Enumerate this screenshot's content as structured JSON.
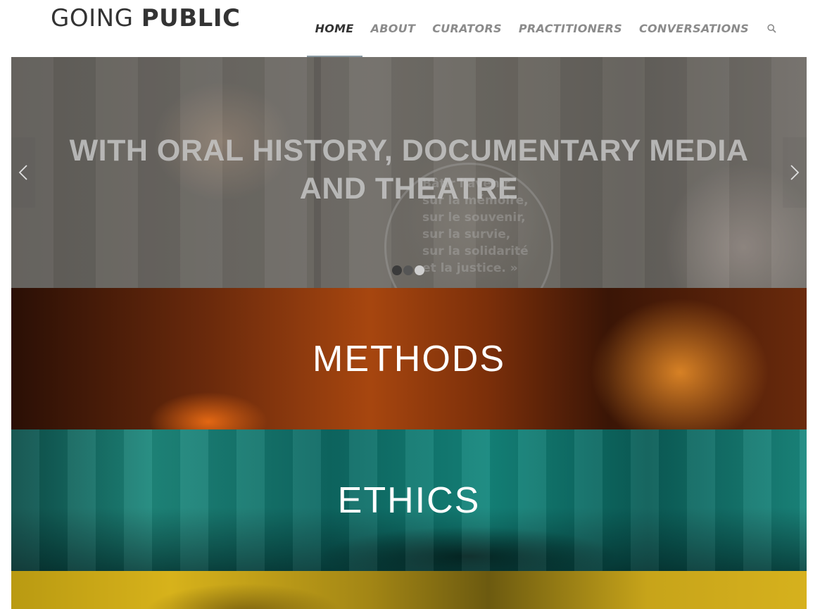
{
  "site": {
    "logo_part1": "GOING",
    "logo_part2": "PUBLIC"
  },
  "nav": {
    "items": [
      {
        "label": "HOME",
        "active": true
      },
      {
        "label": "ABOUT",
        "active": false
      },
      {
        "label": "CURATORS",
        "active": false
      },
      {
        "label": "PRACTITIONERS",
        "active": false
      },
      {
        "label": "CONVERSATIONS",
        "active": false
      }
    ],
    "search_icon": "search-icon"
  },
  "slider": {
    "title": "WITH ORAL HISTORY, DOCUMENTARY MEDIA AND THEATRE",
    "background_text": "Bâtir l'avenir\nsur la mémoire,\nsur le souvenir,\nsur la survie,\nsur la solidarité\net la justice. »",
    "prev_icon": "chevron-left-icon",
    "next_icon": "chevron-right-icon",
    "slide_count": 3,
    "active_slide": 3
  },
  "sections": [
    {
      "title": "METHODS",
      "tint": "#a7460f"
    },
    {
      "title": "ETHICS",
      "tint": "#1f8a7e"
    },
    {
      "title": "",
      "tint": "#d7b21b"
    }
  ],
  "colors": {
    "nav_active": "#333333",
    "nav_inactive": "#8b8b8b",
    "active_underline": "#8a9aa3"
  }
}
